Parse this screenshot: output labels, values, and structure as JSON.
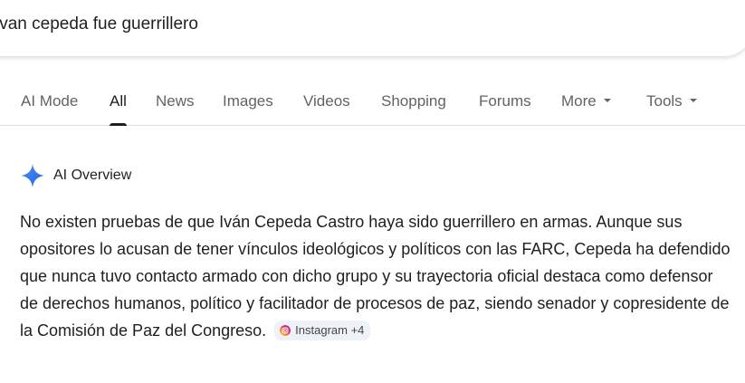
{
  "search": {
    "query": "ivan cepeda fue guerrillero"
  },
  "tabs": [
    {
      "label": "AI Mode"
    },
    {
      "label": "All"
    },
    {
      "label": "News"
    },
    {
      "label": "Images"
    },
    {
      "label": "Videos"
    },
    {
      "label": "Shopping"
    },
    {
      "label": "Forums"
    },
    {
      "label": "More"
    },
    {
      "label": "Tools"
    }
  ],
  "active_tab": "All",
  "ai_overview": {
    "title": "AI Overview",
    "text": "No existen pruebas de que Iván Cepeda Castro haya sido guerrillero en armas. Aunque sus opositores lo acusan de tener vínculos ideológicos y políticos con las FARC, Cepeda ha defendido que nunca tuvo contacto armado con dicho grupo y su trayectoria oficial destaca como defensor de derechos humanos, político y facilitador de procesos de paz, siendo senador y copresidente de la Comisión de Paz del Congreso.",
    "source_chip": "Instagram +4",
    "source_icon": "instagram-icon"
  },
  "colors": {
    "accent_blue": "#4285f4",
    "chip_bg": "#eef1f7",
    "tab_inactive": "#5f6368"
  }
}
